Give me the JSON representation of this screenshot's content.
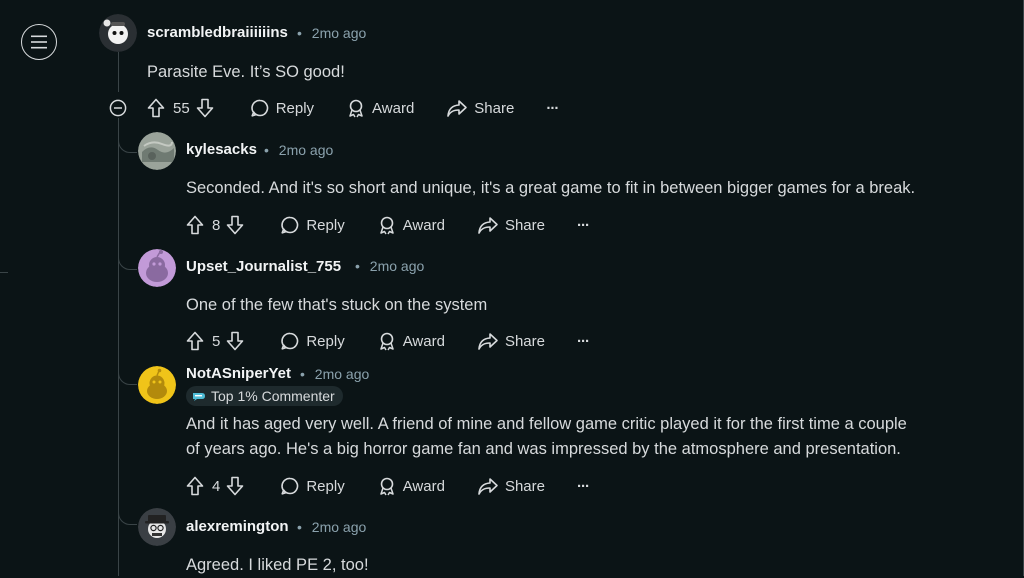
{
  "nav": {
    "menu_icon": "hamburger-icon"
  },
  "comments": [
    {
      "author": "scrambledbraiiiiiins",
      "time": "2mo ago",
      "body": [
        "Parasite Eve. It’s SO good!"
      ],
      "votes": "55",
      "avatar_color": "#2a2f33"
    },
    {
      "author": "kylesacks",
      "time": "2mo ago",
      "body": [
        "Seconded. And it's so short and unique, it's a great game to fit in between bigger games for a break."
      ],
      "votes": "8",
      "avatar_color": "#9aa39a"
    },
    {
      "author": "Upset_Journalist_755",
      "time": "2mo ago",
      "body": [
        "One of the few that's stuck on the system"
      ],
      "votes": "5",
      "avatar_color": "#c29ad8"
    },
    {
      "author": "NotASniperYet",
      "time": "2mo ago",
      "badge": "Top 1% Commenter",
      "body": [
        "And it has aged very well. A friend of mine and fellow game critic played it for the first time a couple",
        "of years ago. He's a big horror game fan and was impressed by the atmosphere and presentation."
      ],
      "votes": "4",
      "avatar_color": "#f0c419"
    },
    {
      "author": "alexremington",
      "time": "2mo ago",
      "body": [
        "Agreed. I liked PE 2, too!"
      ],
      "avatar_color": "#e8e8e8"
    }
  ],
  "actions": {
    "reply": "Reply",
    "award": "Award",
    "share": "Share",
    "more": "···"
  },
  "separator": "•",
  "icons": {
    "upvote": "upvote-arrow-icon",
    "downvote": "downvote-arrow-icon",
    "reply": "speech-bubble-icon",
    "award": "award-ribbon-icon",
    "share": "share-arrow-icon",
    "collapse": "collapse-minus-icon"
  }
}
